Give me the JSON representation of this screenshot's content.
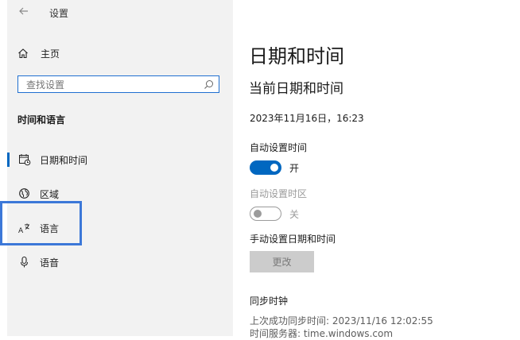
{
  "app": {
    "title": "设置"
  },
  "sidebar": {
    "home_label": "主页",
    "search_placeholder": "查找设置",
    "section_title": "时间和语言",
    "items": [
      {
        "label": "日期和时间",
        "icon": "calendar-clock-icon",
        "selected": true
      },
      {
        "label": "区域",
        "icon": "globe-icon",
        "selected": false
      },
      {
        "label": "语言",
        "icon": "language-icon",
        "selected": false
      },
      {
        "label": "语音",
        "icon": "microphone-icon",
        "selected": false
      }
    ]
  },
  "main": {
    "title": "日期和时间",
    "subtitle": "当前日期和时间",
    "current_datetime": "2023年11月16日，16:23",
    "auto_time": {
      "label": "自动设置时间",
      "state_text": "开",
      "on": true
    },
    "auto_timezone": {
      "label": "自动设置时区",
      "state_text": "关",
      "on": false,
      "disabled": true
    },
    "manual": {
      "label": "手动设置日期和时间",
      "button_label": "更改"
    },
    "sync": {
      "title": "同步时钟",
      "last_sync": "上次成功同步时间: 2023/11/16 12:02:55",
      "server": "时间服务器: time.windows.com"
    }
  },
  "colors": {
    "accent": "#0067c0",
    "highlight": "#3c78d8",
    "sidebar_bg": "#f2f2f2"
  }
}
